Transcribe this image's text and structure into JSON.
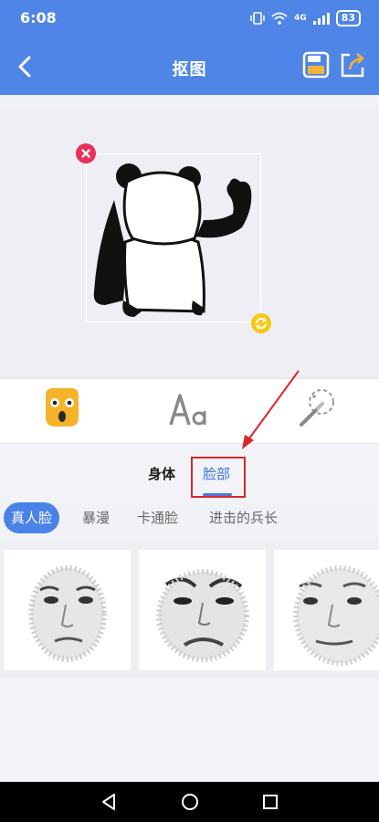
{
  "status_bar": {
    "time": "6:08",
    "network": "4G",
    "battery": "83"
  },
  "header": {
    "title": "抠图",
    "back_icon": "back-chevron-icon",
    "save_icon": "save-icon",
    "share_icon": "share-icon"
  },
  "canvas": {
    "sticker": "panda-body-sticker",
    "delete_icon": "close-icon",
    "rotate_icon": "rotate-icon"
  },
  "tools": [
    {
      "name": "emoji-face-icon"
    },
    {
      "name": "text-tool-icon",
      "label": "Aa"
    },
    {
      "name": "magic-wand-icon"
    }
  ],
  "tabs": {
    "body": "身体",
    "face": "脸部",
    "selected": "脸部"
  },
  "chips": [
    "真人脸",
    "暴漫",
    "卡通脸",
    "进击的兵长"
  ],
  "chip_selected": "真人脸",
  "colors": {
    "primary": "#4f85e6",
    "accent_red": "#d9272b",
    "delete_red": "#e7305a",
    "rotate_yellow": "#f5c816"
  },
  "nav": [
    "back-triangle-icon",
    "home-circle-icon",
    "recents-square-icon"
  ]
}
